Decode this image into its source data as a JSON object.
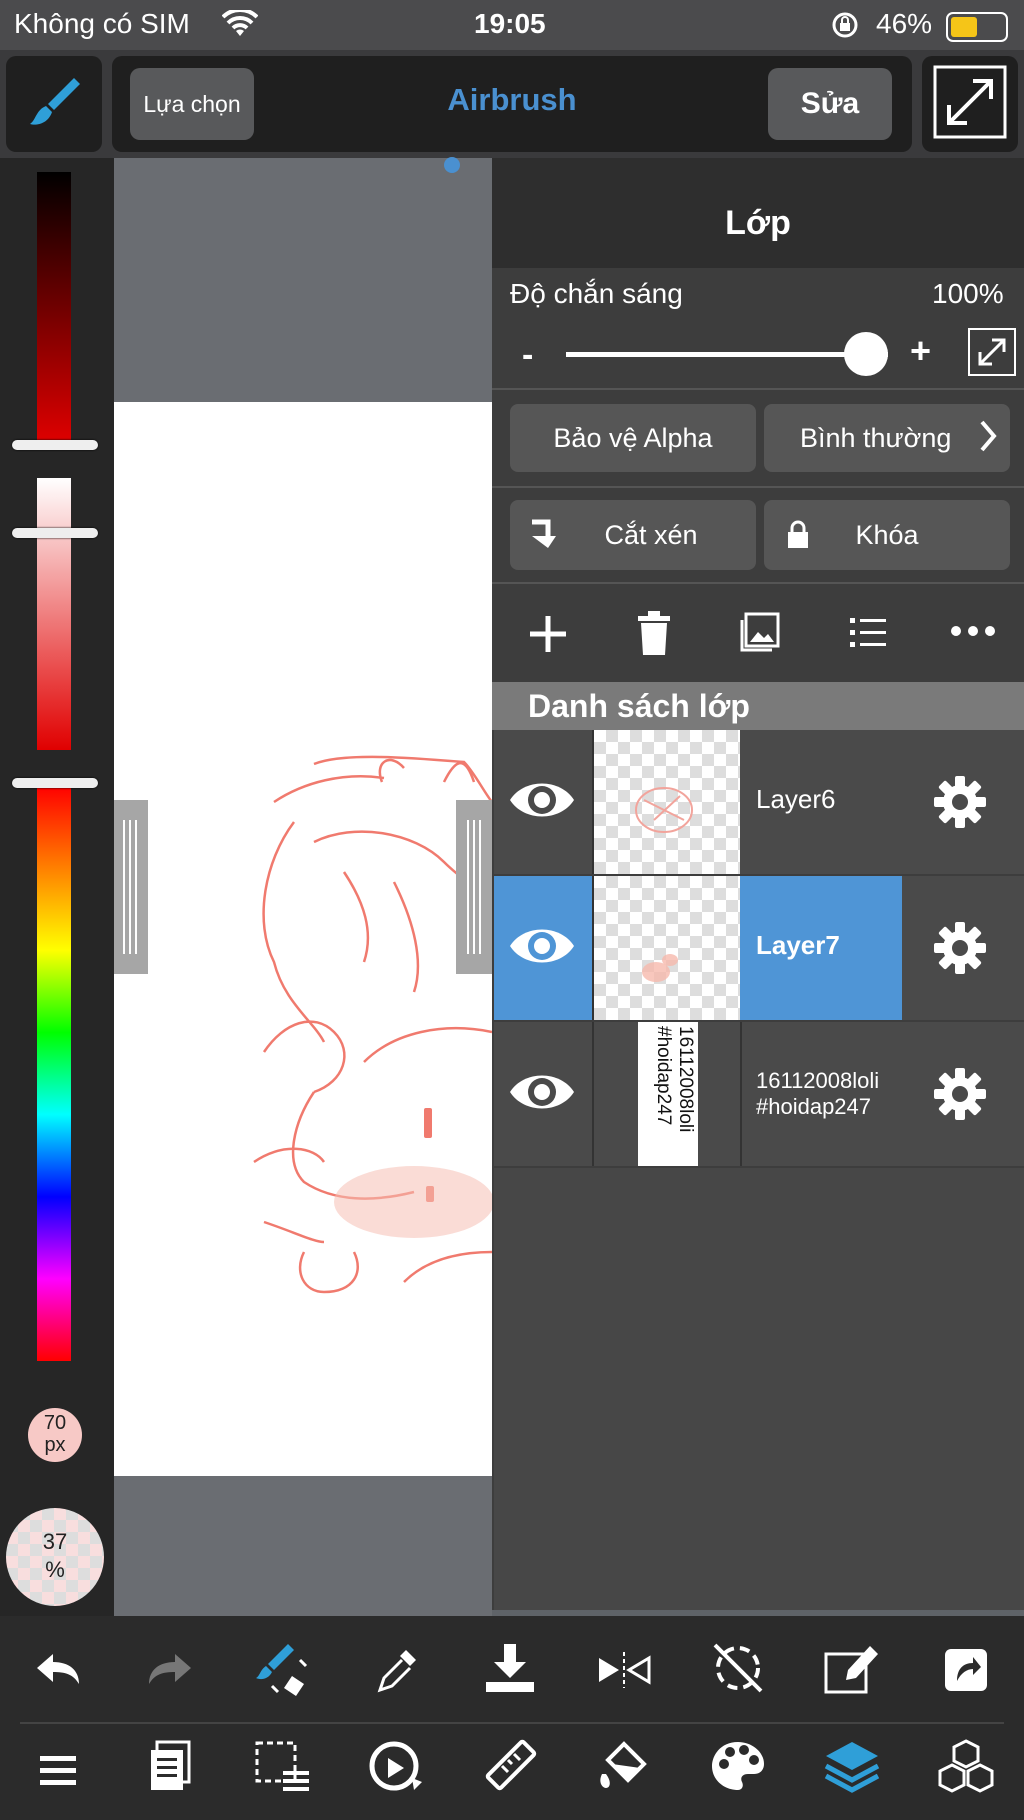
{
  "status_bar": {
    "carrier": "Không có SIM",
    "time": "19:05",
    "battery": "46%"
  },
  "toolbar": {
    "select_label": "Lựa chọn",
    "brush_name": "Airbrush",
    "edit_label": "Sửa"
  },
  "left_bar": {
    "brush_size": "70\npx",
    "opacity": "37\n%"
  },
  "layer_panel": {
    "title": "Lớp",
    "opacity_label": "Độ chắn sáng",
    "opacity_value": "100%",
    "opacity_level": 1.0,
    "minus": "-",
    "plus": "+",
    "alpha_protect": "Bảo vệ Alpha",
    "blend_mode": "Bình thường",
    "clipping": "Cắt xén",
    "lock": "Khóa",
    "list_header": "Danh sách lớp",
    "layers": [
      {
        "name": "Layer6",
        "selected": false
      },
      {
        "name": "Layer7",
        "selected": true
      },
      {
        "name": "16112008loli\n#hoidap247",
        "selected": false,
        "thumb_text": "16112008loli\n#hoidap247"
      }
    ]
  },
  "colors": {
    "accent": "#4a90d0",
    "selected_row": "#4f95d6",
    "panel": "#3d3d3d",
    "stroke": "#f07a6e"
  }
}
